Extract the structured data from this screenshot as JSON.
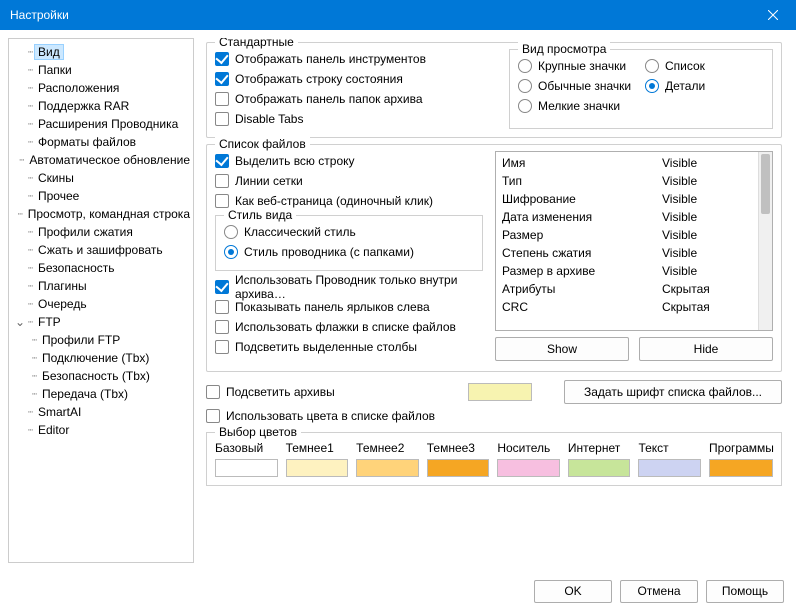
{
  "window": {
    "title": "Настройки"
  },
  "tree": {
    "items": [
      {
        "label": "Вид",
        "level": 0,
        "selected": true
      },
      {
        "label": "Папки",
        "level": 0
      },
      {
        "label": "Расположения",
        "level": 0
      },
      {
        "label": "Поддержка RAR",
        "level": 0
      },
      {
        "label": "Расширения Проводника",
        "level": 0
      },
      {
        "label": "Форматы файлов",
        "level": 0
      },
      {
        "label": "Автоматическое обновление",
        "level": 0
      },
      {
        "label": "Скины",
        "level": 0
      },
      {
        "label": "Прочее",
        "level": 0
      },
      {
        "label": "Просмотр, командная строка",
        "level": 0
      },
      {
        "label": "Профили сжатия",
        "level": 0
      },
      {
        "label": "Сжать и зашифровать",
        "level": 0
      },
      {
        "label": "Безопасность",
        "level": 0
      },
      {
        "label": "Плагины",
        "level": 0
      },
      {
        "label": "Очередь",
        "level": 0
      },
      {
        "label": "FTP",
        "level": 0,
        "expandable": true,
        "expanded": true
      },
      {
        "label": "Профили FTP",
        "level": 1
      },
      {
        "label": "Подключение (Tbx)",
        "level": 1
      },
      {
        "label": "Безопасность (Tbx)",
        "level": 1
      },
      {
        "label": "Передача (Tbx)",
        "level": 1
      },
      {
        "label": "SmartAI",
        "level": 0
      },
      {
        "label": "Editor",
        "level": 0
      }
    ]
  },
  "standard": {
    "legend": "Стандартные",
    "opts": [
      {
        "label": "Отображать панель инструментов",
        "checked": true
      },
      {
        "label": "Отображать строку состояния",
        "checked": true
      },
      {
        "label": "Отображать панель папок архива",
        "checked": false
      },
      {
        "label": "Disable Tabs",
        "checked": false
      }
    ],
    "viewmode": {
      "legend": "Вид просмотра",
      "left": [
        {
          "label": "Крупные значки",
          "checked": false
        },
        {
          "label": "Обычные значки",
          "checked": false
        },
        {
          "label": "Мелкие значки",
          "checked": false
        }
      ],
      "right": [
        {
          "label": "Список",
          "checked": false
        },
        {
          "label": "Детали",
          "checked": true
        }
      ]
    }
  },
  "filelist": {
    "legend": "Список файлов",
    "left1": [
      {
        "label": "Выделить всю строку",
        "checked": true
      },
      {
        "label": "Линии сетки",
        "checked": false
      },
      {
        "label": "Как веб-страница (одиночный клик)",
        "checked": false
      }
    ],
    "style": {
      "legend": "Стиль вида",
      "opts": [
        {
          "label": "Классический стиль",
          "checked": false
        },
        {
          "label": "Стиль проводника (с папками)",
          "checked": true
        }
      ]
    },
    "left2": [
      {
        "label": "Использовать Проводник только внутри архива…",
        "checked": true
      },
      {
        "label": "Показывать панель ярлыков слева",
        "checked": false
      },
      {
        "label": "Использовать флажки в списке файлов",
        "checked": false
      },
      {
        "label": "Подсветить выделенные столбы",
        "checked": false
      }
    ],
    "columns": [
      {
        "name": "Имя",
        "vis": "Visible"
      },
      {
        "name": "Тип",
        "vis": "Visible"
      },
      {
        "name": "Шифрование",
        "vis": "Visible"
      },
      {
        "name": "Дата изменения",
        "vis": "Visible"
      },
      {
        "name": "Размер",
        "vis": "Visible"
      },
      {
        "name": "Степень сжатия",
        "vis": "Visible"
      },
      {
        "name": "Размер в архиве",
        "vis": "Visible"
      },
      {
        "name": "Атрибуты",
        "vis": "Скрытая"
      },
      {
        "name": "CRC",
        "vis": "Скрытая"
      }
    ],
    "btn_show": "Show",
    "btn_hide": "Hide"
  },
  "archive_highlight": {
    "label": "Подсветить архивы",
    "checked": false,
    "swatch": "#f7f3b0"
  },
  "use_colors": {
    "label": "Использовать цвета в списке файлов",
    "checked": false
  },
  "set_font": "Задать шрифт списка файлов...",
  "colors": {
    "legend": "Выбор цветов",
    "items": [
      {
        "label": "Базовый",
        "color": "#ffffff"
      },
      {
        "label": "Темнее1",
        "color": "#fef2c0"
      },
      {
        "label": "Темнее2",
        "color": "#ffd37a"
      },
      {
        "label": "Темнее3",
        "color": "#f5a623"
      },
      {
        "label": "Носитель",
        "color": "#f7bfe0"
      },
      {
        "label": "Интернет",
        "color": "#c7e59a"
      },
      {
        "label": "Текст",
        "color": "#cdd3f2"
      },
      {
        "label": "Программы",
        "color": "#f5a623"
      }
    ]
  },
  "footer": {
    "ok": "OK",
    "cancel": "Отмена",
    "help": "Помощь"
  }
}
